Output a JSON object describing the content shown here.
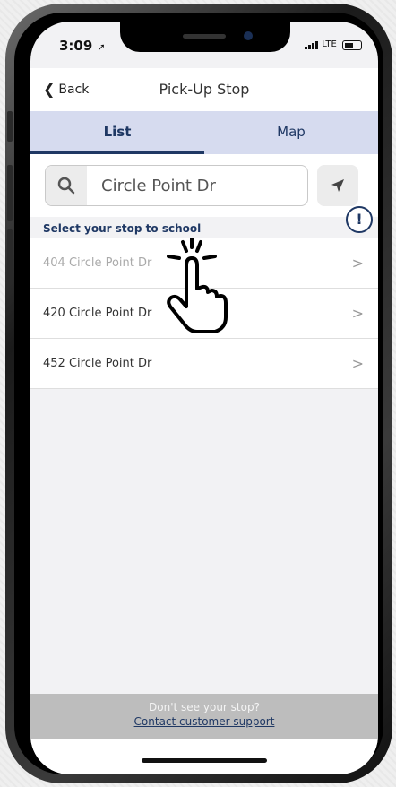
{
  "status": {
    "time": "3:09",
    "carrier": "LTE"
  },
  "nav": {
    "back_label": "Back",
    "title": "Pick-Up Stop"
  },
  "tabs": [
    {
      "label": "List",
      "active": true
    },
    {
      "label": "Map",
      "active": false
    }
  ],
  "search": {
    "value": "Circle Point Dr",
    "placeholder": "Search"
  },
  "list": {
    "header": "Select your stop to school",
    "items": [
      {
        "label": "404 Circle Point Dr"
      },
      {
        "label": "420 Circle Point Dr"
      },
      {
        "label": "452 Circle Point Dr"
      }
    ]
  },
  "footer": {
    "question": "Don't see your stop?",
    "link": "Contact customer support"
  },
  "info_badge": {
    "label": "!"
  },
  "colors": {
    "accent": "#1f3864",
    "tab_bg": "#d6dbef",
    "footer_bg": "#bdbdbd"
  }
}
